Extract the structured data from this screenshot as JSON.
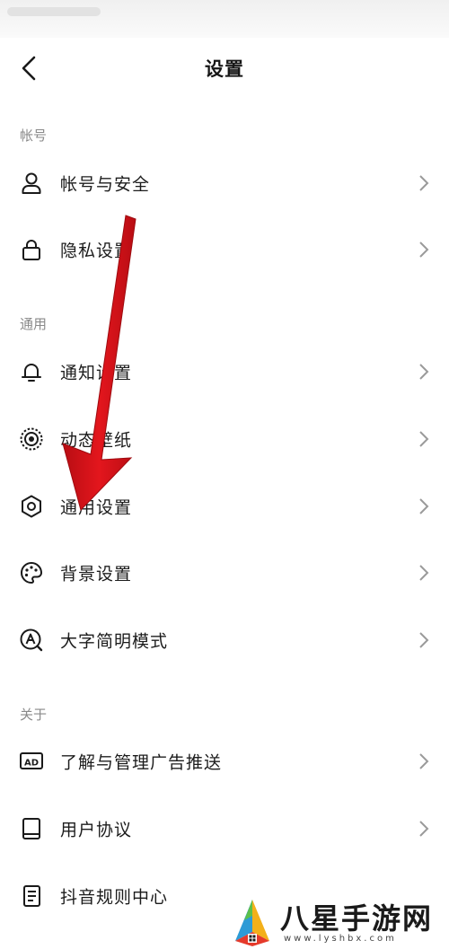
{
  "header": {
    "title": "设置",
    "back_icon": "chevron-left-icon"
  },
  "sections": {
    "account": {
      "label": "帐号",
      "items": [
        {
          "label": "帐号与安全",
          "icon": "user-icon"
        },
        {
          "label": "隐私设置",
          "icon": "lock-icon"
        }
      ]
    },
    "general": {
      "label": "通用",
      "items": [
        {
          "label": "通知设置",
          "icon": "bell-icon"
        },
        {
          "label": "动态壁纸",
          "icon": "live-wallpaper-icon"
        },
        {
          "label": "通用设置",
          "icon": "gear-icon"
        },
        {
          "label": "背景设置",
          "icon": "palette-icon"
        },
        {
          "label": "大字简明模式",
          "icon": "large-font-icon"
        }
      ]
    },
    "about": {
      "label": "关于",
      "items": [
        {
          "label": "了解与管理广告推送",
          "icon": "ad-icon"
        },
        {
          "label": "用户协议",
          "icon": "book-icon"
        },
        {
          "label": "抖音规则中心",
          "icon": "document-icon"
        }
      ]
    }
  },
  "watermark": {
    "text": "八星手游网",
    "url": "www.lyshbx.com"
  },
  "colors": {
    "arrow": "#d8141b",
    "section_label": "#8a8a8a",
    "chevron": "#9a9a9a"
  }
}
